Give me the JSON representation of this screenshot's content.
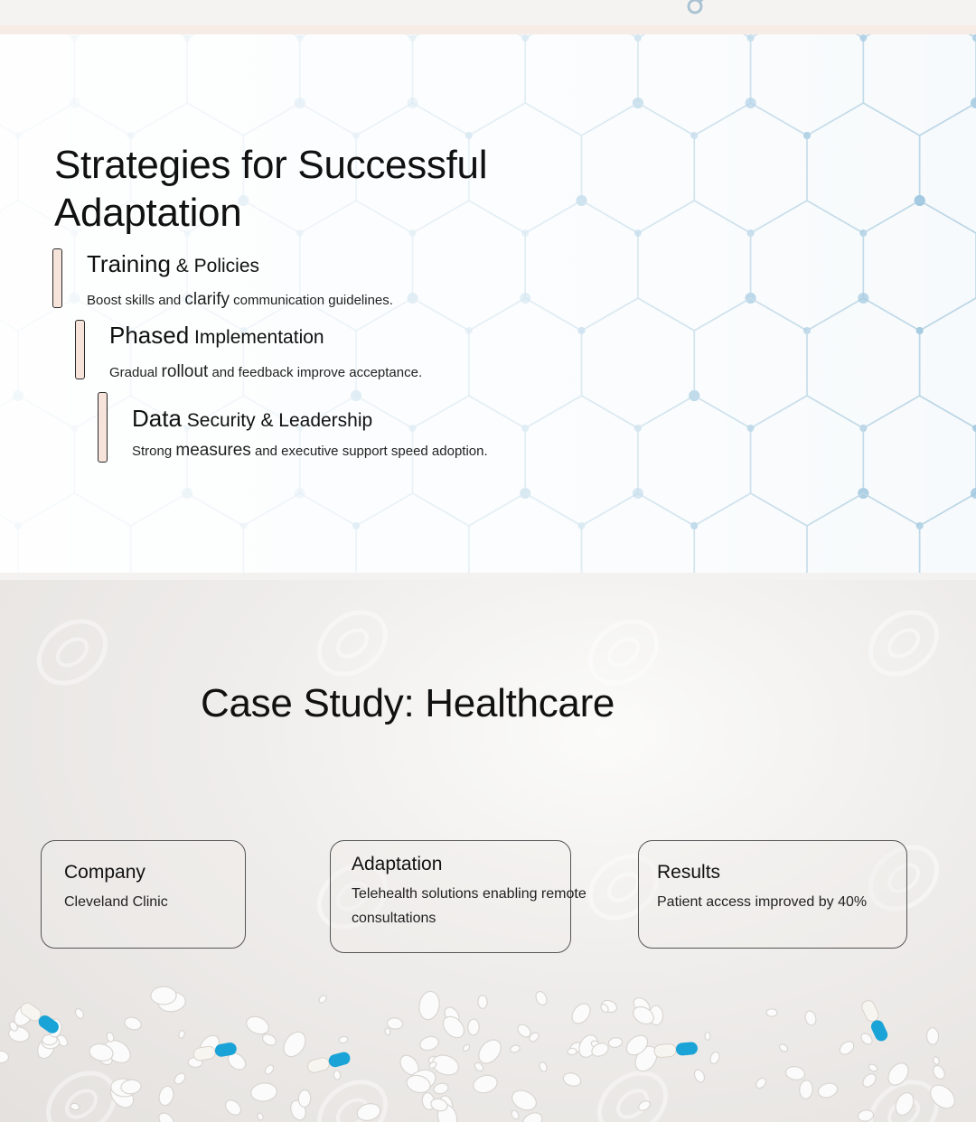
{
  "colors": {
    "accent_bar_fill": "#f6e4da",
    "accent_bar_border": "#2b2b2b",
    "hex_line": "#b7d4e4",
    "hex_node": "#9cc6df",
    "capsule_blue": "#1aa3d6"
  },
  "header": {
    "icon": "ring-icon"
  },
  "slide1": {
    "title": "Strategies for Successful Adaptation",
    "background_icon": "hexagon-network",
    "items": [
      {
        "head_big": "Training",
        "head_small": " & Policies",
        "desc_pre": "Boost skills and ",
        "desc_big": "clarify",
        "desc_post": " communication guidelines."
      },
      {
        "head_big": "Phased",
        "head_small": " Implementation",
        "desc_pre": "Gradual ",
        "desc_big": "rollout",
        "desc_post": " and feedback improve acceptance."
      },
      {
        "head_big": "Data",
        "head_small": " Security & Leadership",
        "desc_pre": "Strong ",
        "desc_big": "measures",
        "desc_post": " and executive support speed adoption."
      }
    ]
  },
  "slide2": {
    "title": "Case Study: Healthcare",
    "watermark_icon": "123rf-watermark",
    "background_icon": "pills-photo",
    "cards": [
      {
        "title": "Company",
        "value": "Cleveland Clinic"
      },
      {
        "title": "Adaptation",
        "value": "Telehealth solutions enabling remote consultations"
      },
      {
        "title": "Results",
        "value": "Patient access improved by 40%"
      }
    ]
  }
}
